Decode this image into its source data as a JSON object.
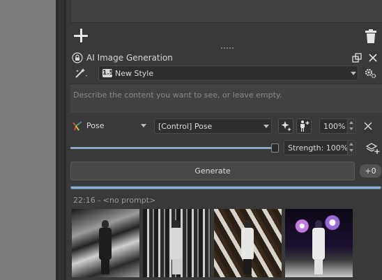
{
  "panel": {
    "title": "AI Image Generation",
    "style": {
      "badge": "1.5",
      "name": "New Style"
    },
    "prompt_placeholder": "Describe the content you want to see, or leave empty."
  },
  "control_layer": {
    "mode": "Pose",
    "layer": "[Control] Pose",
    "strength_percent": "100%"
  },
  "strength": {
    "label": "Strength: 100%",
    "value": 1.0
  },
  "generate": {
    "label": "Generate",
    "batch_count": "+0"
  },
  "progress": {
    "value": 1.0
  },
  "history": {
    "header": "22:16 - <no prompt>",
    "thumbnails": [
      {
        "name": "result-1"
      },
      {
        "name": "result-2"
      },
      {
        "name": "result-3"
      },
      {
        "name": "result-4"
      }
    ]
  },
  "colors": {
    "accent": "#8fb0d4",
    "panel_bg": "#393939",
    "input_bg": "#2e2e2e"
  },
  "icons": [
    "add-icon",
    "trash-icon",
    "lock-icon",
    "float-icon",
    "close-icon",
    "wand-icon",
    "settings-icon",
    "pose-icon",
    "sparkle-icon",
    "person-add-icon",
    "add-layer-icon"
  ]
}
